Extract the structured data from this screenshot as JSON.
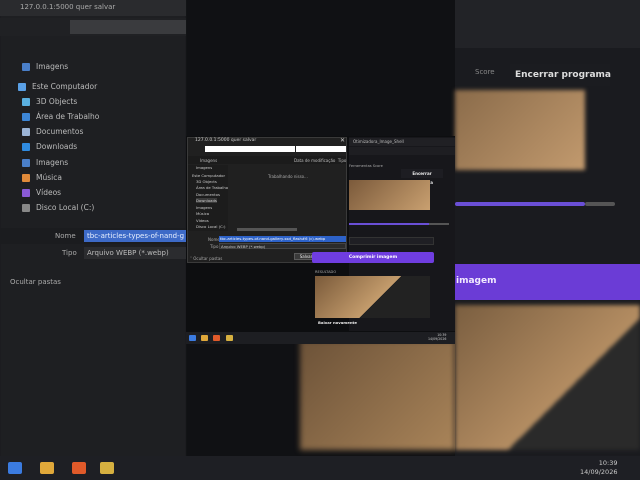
{
  "background": {
    "left_window": {
      "title": "127.0.0.1:5000 quer salvar",
      "nav_items": [
        {
          "label": "Imagens",
          "icon": "images-icon"
        },
        {
          "label": "Este Computador",
          "icon": "computer-icon"
        },
        {
          "label": "3D Objects",
          "icon": "cube-icon"
        },
        {
          "label": "Área de Trabalho",
          "icon": "desktop-icon"
        },
        {
          "label": "Documentos",
          "icon": "document-icon"
        },
        {
          "label": "Downloads",
          "icon": "download-icon"
        },
        {
          "label": "Imagens",
          "icon": "images-icon"
        },
        {
          "label": "Música",
          "icon": "music-icon"
        },
        {
          "label": "Vídeos",
          "icon": "video-icon"
        },
        {
          "label": "Disco Local (C:)",
          "icon": "drive-icon"
        }
      ],
      "name_label": "Nome",
      "name_value": "tbc-articles-types-of-nand-g",
      "type_label": "Tipo",
      "type_value": "Arquivo WEBP (*.webp)",
      "hide_folders": "Ocultar pastas"
    },
    "right_window": {
      "tabs": [
        "Score"
      ],
      "end_button": "Encerrar programa",
      "compress_text": "imagem"
    },
    "taskbar": {
      "time": "10:39",
      "date": "14/09/2026"
    }
  },
  "dialog": {
    "title": "127.0.0.1:5000 quer salvar",
    "toolbar_label": "Imagens",
    "sort_label": "Data de modificação",
    "sort_type": "Tipo",
    "sidebar": [
      {
        "label": "Imagens",
        "selected": false
      },
      {
        "label": "Este Computador",
        "selected": false
      },
      {
        "label": "3D Objects",
        "selected": false
      },
      {
        "label": "Área de Trabalho",
        "selected": false
      },
      {
        "label": "Documentos",
        "selected": false
      },
      {
        "label": "Downloads",
        "selected": true
      },
      {
        "label": "Imagens",
        "selected": false
      },
      {
        "label": "Música",
        "selected": false
      },
      {
        "label": "Vídeos",
        "selected": false
      },
      {
        "label": "Disco Local (C:)",
        "selected": false
      }
    ],
    "status": "Trabalhando nisso...",
    "name_label": "Nome",
    "name_value": "tbc-articles-types-of-nand-gallery-ssd_flash#6 (c).webp",
    "type_label": "Tipo",
    "type_value": "Arquivo WEBP (*.webp)",
    "hide_folders": "Ocultar pastas",
    "save_button": "Salvar",
    "cancel_button": "Cancelar"
  },
  "browser": {
    "tab_title": "Otimizadora_Image_Shell",
    "tabs_row": "Ferramentas    Score",
    "end_button": "Encerrar programa",
    "compress_button": "Comprimir imagem",
    "result_label": "RESULTADO",
    "download_button": "Baixar novamente"
  },
  "frame_taskbar": {
    "time": "10:39",
    "date": "14/09/2026"
  },
  "colors": {
    "accent_purple": "#6f3de0",
    "selection_blue": "#2d62c8",
    "background": "#15161a"
  }
}
